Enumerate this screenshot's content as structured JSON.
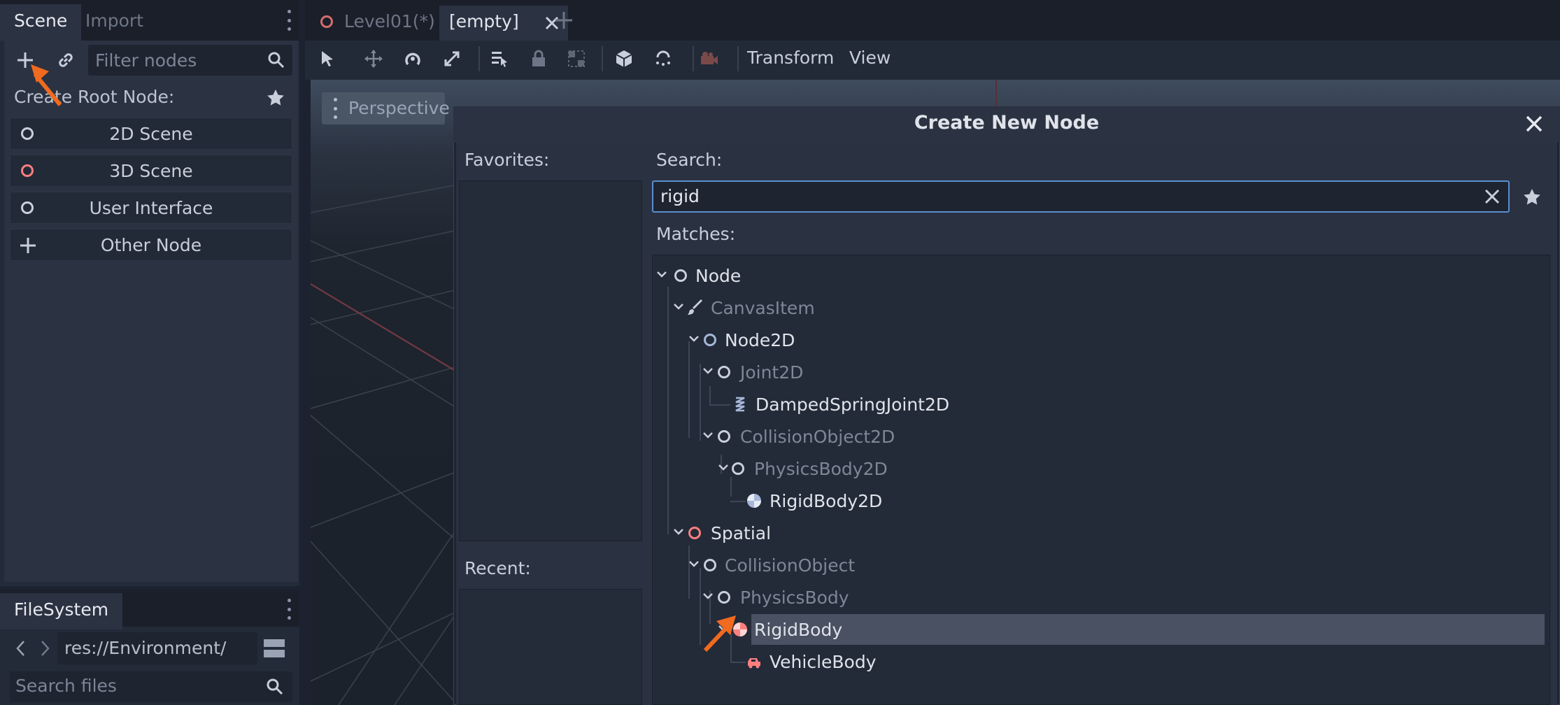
{
  "scene_dock": {
    "tabs": [
      "Scene",
      "Import"
    ],
    "filter_placeholder": "Filter nodes",
    "create_root_label": "Create Root Node:",
    "root_buttons": [
      "2D Scene",
      "3D Scene",
      "User Interface",
      "Other Node"
    ]
  },
  "filesystem": {
    "tab": "FileSystem",
    "path": "res://Environment/",
    "search_placeholder": "Search files"
  },
  "editor": {
    "tabs": [
      "Level01(*)",
      "[empty]"
    ],
    "toolbar_menus": [
      "Transform",
      "View"
    ],
    "viewport_label": "Perspective"
  },
  "dialog": {
    "title": "Create New Node",
    "favorites_label": "Favorites:",
    "recent_label": "Recent:",
    "search_label": "Search:",
    "search_value": "rigid",
    "matches_label": "Matches:",
    "tree": [
      "Node",
      "CanvasItem",
      "Node2D",
      "Joint2D",
      "DampedSpringJoint2D",
      "CollisionObject2D",
      "PhysicsBody2D",
      "RigidBody2D",
      "Spatial",
      "CollisionObject",
      "PhysicsBody",
      "RigidBody",
      "VehicleBody"
    ],
    "selected": "RigidBody"
  },
  "colors": {
    "accent_orange": "#f06a1f",
    "spatial_red": "#fc7f7f",
    "search_focus": "#5a8fd1"
  }
}
